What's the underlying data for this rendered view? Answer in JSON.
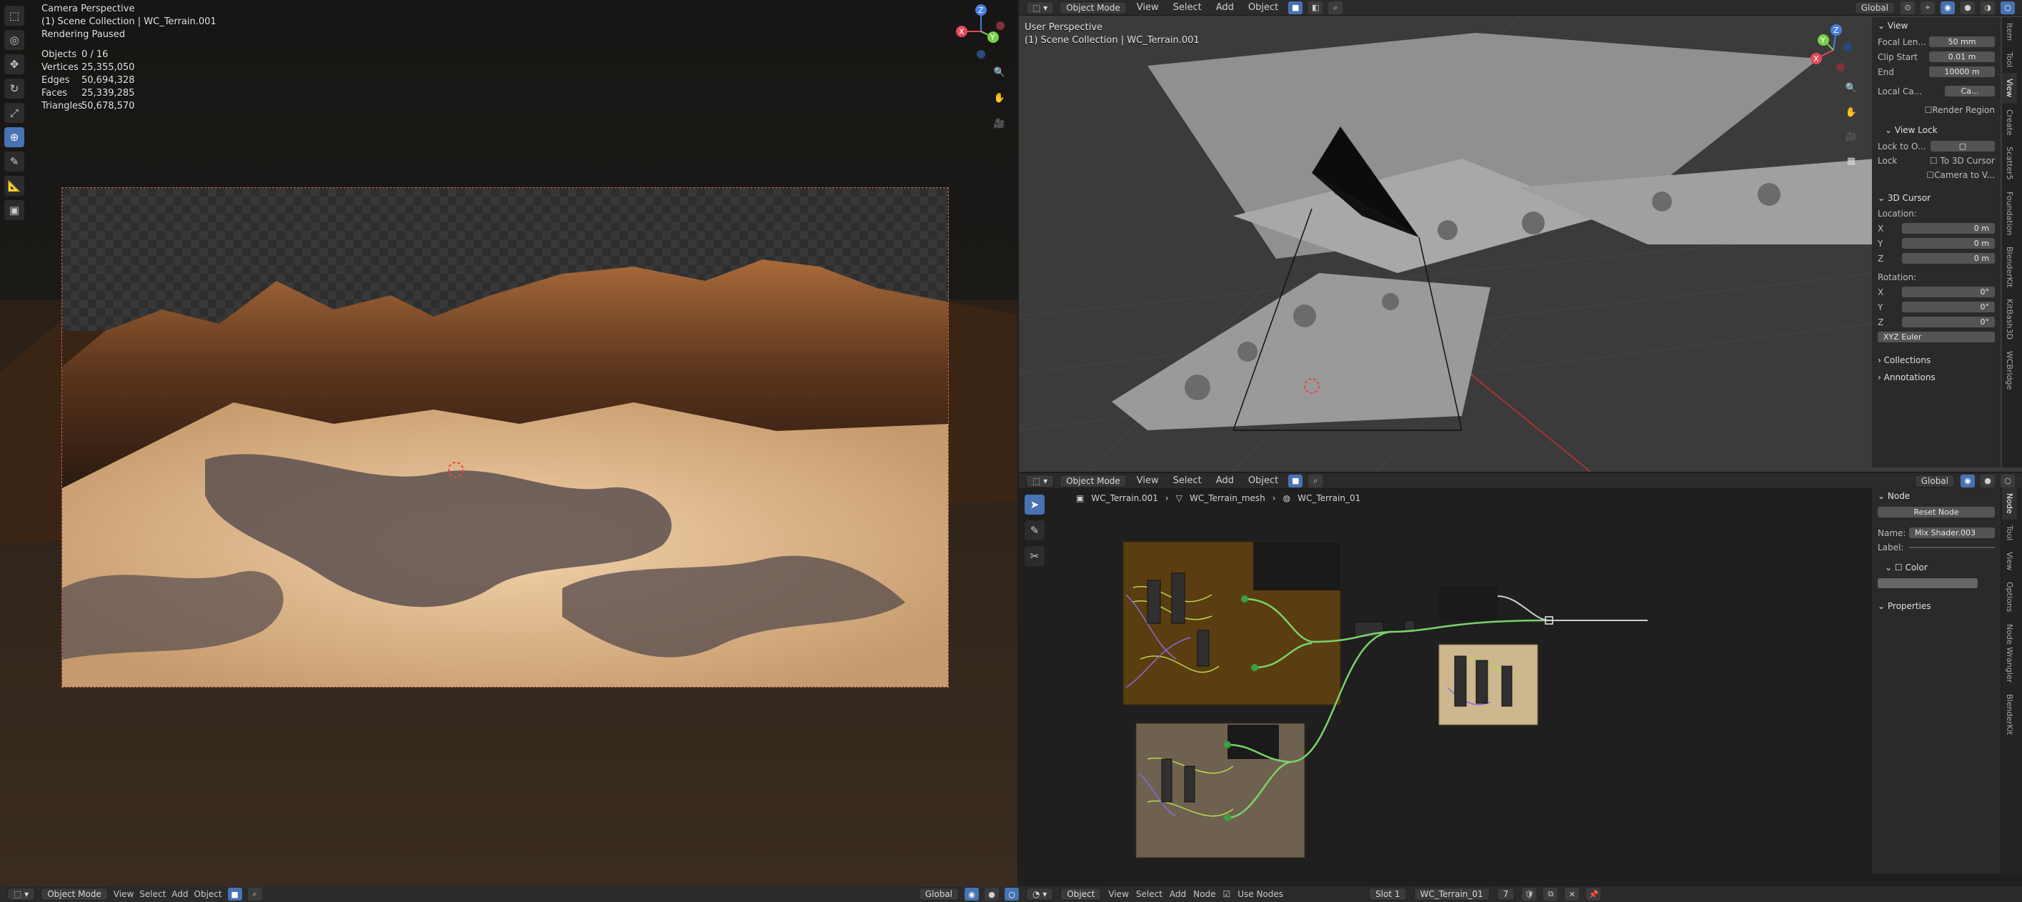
{
  "left_view": {
    "header": {
      "mode": "Object Mode",
      "menus": [
        "View",
        "Select",
        "Add",
        "Object"
      ],
      "orientation": "Global"
    },
    "overlay": {
      "perspective": "Camera Perspective",
      "collection": "(1) Scene Collection | WC_Terrain.001",
      "status": "Rendering Paused",
      "stats": [
        {
          "label": "Objects",
          "value": "0 / 16"
        },
        {
          "label": "Vertices",
          "value": "25,355,050"
        },
        {
          "label": "Edges",
          "value": "50,694,328"
        },
        {
          "label": "Faces",
          "value": "25,339,285"
        },
        {
          "label": "Triangles",
          "value": "50,678,570"
        }
      ]
    },
    "tools": [
      "select-box",
      "cursor",
      "move",
      "rotate",
      "scale",
      "transform",
      "annotate",
      "measure",
      "add-cube"
    ]
  },
  "right_top_view": {
    "header": {
      "mode": "Object Mode",
      "menus": [
        "View",
        "Select",
        "Add",
        "Object"
      ],
      "orientation": "Global"
    },
    "overlay": {
      "perspective": "User Perspective",
      "collection": "(1) Scene Collection | WC_Terrain.001"
    },
    "npanel": {
      "view_section": "View",
      "focal_length_label": "Focal Len...",
      "focal_length": "50 mm",
      "clip_start_label": "Clip Start",
      "clip_start": "0.01 m",
      "end_label": "End",
      "end": "10000 m",
      "local_camera_label": "Local Ca...",
      "local_camera_value": "Ca...",
      "render_region": "Render Region",
      "view_lock": "View Lock",
      "lock_to_object": "Lock to O...",
      "lock_label": "Lock",
      "to_3d_cursor": "To 3D Cursor",
      "camera_to_view": "Camera to V...",
      "cursor_section": "3D Cursor",
      "location_label": "Location:",
      "loc_x": "0 m",
      "loc_y": "0 m",
      "loc_z": "0 m",
      "rotation_label": "Rotation:",
      "rot_x": "0°",
      "rot_y": "0°",
      "rot_z": "0°",
      "rotation_mode": "XYZ Euler",
      "collections": "Collections",
      "annotations": "Annotations"
    },
    "vtabs": [
      "Item",
      "Tool",
      "View",
      "Create",
      "Scatter5",
      "Foundation",
      "BlenderKit",
      "KitBash3D",
      "WCBridge"
    ]
  },
  "node_editor": {
    "header": {
      "mode": "Object Mode",
      "menus": [
        "View",
        "Select",
        "Add",
        "Object"
      ],
      "orientation": "Global"
    },
    "breadcrumb": [
      "WC_Terrain.001",
      "WC_Terrain_mesh",
      "WC_Terrain_01"
    ],
    "npanel": {
      "section": "Node",
      "reset": "Reset Node",
      "name_label": "Name:",
      "name_value": "Mix Shader.003",
      "label_label": "Label:",
      "color": "Color",
      "properties": "Properties"
    },
    "vtabs": [
      "Node",
      "Tool",
      "View",
      "Options",
      "Node Wrangler",
      "BlenderKit"
    ]
  },
  "footer": {
    "left": {
      "object_label": "Object",
      "menus": [
        "View",
        "Select",
        "Add",
        "Node"
      ],
      "use_nodes": "Use Nodes",
      "slot": "Slot 1",
      "material": "WC_Terrain_01",
      "users": "7"
    },
    "left_view": {
      "mode": "Object Mode",
      "menus": [
        "View",
        "Select",
        "Add",
        "Object"
      ],
      "orientation": "Global"
    }
  },
  "colors": {
    "accent": "#4772b3",
    "frame_red": "#d36a5a",
    "node_frame_orange": "#5a3d10",
    "node_frame_tan": "#6e6150",
    "wire_green": "#7bd36a"
  }
}
